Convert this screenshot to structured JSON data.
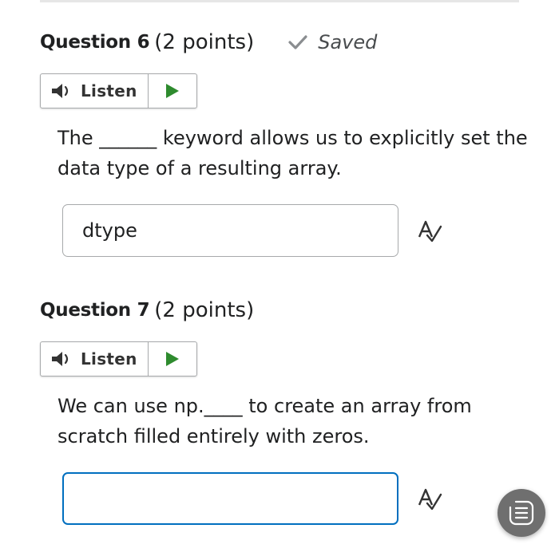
{
  "questions": [
    {
      "title": "Question 6",
      "points": "(2 points)",
      "status": "Saved",
      "listen_label": "Listen",
      "text": "The ______ keyword allows us to explicitly set the data type of a resulting array.",
      "answer": "dtype"
    },
    {
      "title": "Question 7",
      "points": "(2 points)",
      "listen_label": "Listen",
      "text": "We can use np.____ to create an array from scratch filled entirely with zeros.",
      "answer": ""
    }
  ],
  "icons": {
    "saved": "checkmark-icon",
    "listen": "speaker-icon",
    "play": "play-icon",
    "spellcheck": "spellcheck-icon",
    "fab": "transcript-icon"
  },
  "colors": {
    "play_green": "#2e8b2e",
    "focus_blue": "#006fbf",
    "fab_gray": "#6f6f6f"
  }
}
